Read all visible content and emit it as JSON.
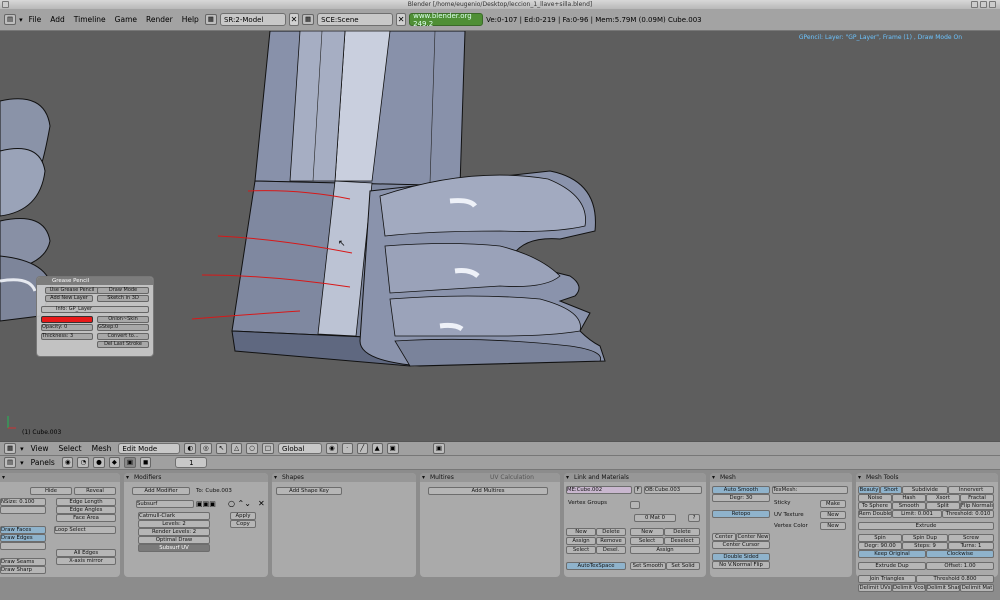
{
  "window_title": "Blender [/home/eugenio/Desktop/leccion_1_llave+silla.blend]",
  "menu": [
    "File",
    "Add",
    "Timeline",
    "Game",
    "Render",
    "Help"
  ],
  "screen_field": "SR:2-Model",
  "scene_field": "SCE:Scene",
  "website": "www.blender.org 249.2",
  "stats": "Ve:0-107 | Ed:0-219 | Fa:0-96 | Mem:5.79M (0.09M) Cube.003",
  "gp_info": "GPencil: Layer: \"GP_Layer\", Frame (1) , Draw Mode On",
  "object_info": "(1) Cube.003",
  "grease_pencil": {
    "title": "Grease Pencil",
    "use_btn": "Use Grease Pencil",
    "draw_mode": "Draw Mode",
    "add_layer": "Add New Layer",
    "sketch": "Sketch in 3D",
    "layer": "Info: GP_Layer",
    "onion": "Onion~Skin",
    "opacity": "Opacity: 0",
    "gstep": "GStep:0",
    "thickness": "Thickness: 3",
    "convert": "Convert to...",
    "del_stroke": "Del Last Stroke",
    "layer_color": "#e81818"
  },
  "view_header": {
    "view": "View",
    "select": "Select",
    "mesh": "Mesh",
    "mode": "Edit Mode",
    "orient": "Global"
  },
  "buttons_header": {
    "panels": "Panels",
    "frame": "1"
  },
  "panels": {
    "left": {
      "hide": "Hide",
      "reveal": "Reveal",
      "nsize": "NSize: 0.100",
      "edge_length": "Edge Length",
      "edge_angles": "Edge Angles",
      "face_area": "Face Area",
      "draw_faces": "Draw Faces",
      "draw_edges": "Draw Edges",
      "loop_select": "Loop Select",
      "all_edges": "All Edges",
      "xaxis_mirror": "X-axis mirror",
      "draw_seams": "Draw Seams",
      "draw_sharp": "Draw Sharp"
    },
    "modifiers": {
      "title": "Modifiers",
      "add": "Add Modifier",
      "to": "To: Cube.003",
      "subsurf": "Subsurf",
      "catmull": "Catmull-Clark",
      "levels": "Levels: 2",
      "render_levels": "Render Levels: 2",
      "optimal": "Optimal Draw",
      "subsurf_uv": "Subsurf UV",
      "apply": "Apply",
      "copy": "Copy"
    },
    "shapes": {
      "title": "Shapes",
      "add": "Add Shape Key"
    },
    "multires": {
      "title": "Multires",
      "tab2": "UV Calculation",
      "add": "Add Multires"
    },
    "link": {
      "title": "Link and Materials",
      "me": "ME:Cube.002",
      "f": "F",
      "ob": "OB:Cube.003",
      "vgroups": "Vertex Groups",
      "mat": "0 Mat 0",
      "q": "?",
      "new1": "New",
      "delete1": "Delete",
      "new2": "New",
      "delete2": "Delete",
      "assign1": "Assign",
      "remove": "Remove",
      "select1": "Select",
      "deselect1": "Deselect",
      "select2": "Select",
      "desel2": "Desel.",
      "assign2": "Assign",
      "autotex": "AutoTexSpace",
      "setsmooth": "Set Smooth",
      "setsolid": "Set Solid"
    },
    "mesh": {
      "title": "Mesh",
      "autosmooth": "Auto Smooth",
      "degr": "Degr: 30",
      "retopo": "Retopo",
      "texmesh": "TexMesh:",
      "sticky": "Sticky",
      "make": "Make",
      "uvtex": "UV Texture",
      "new1": "New",
      "vcolor": "Vertex Color",
      "new2": "New",
      "center": "Center",
      "centernew": "Center New",
      "centercursor": "Center Cursor",
      "doublesided": "Double Sided",
      "novnormal": "No V.Normal Flip"
    },
    "tools": {
      "title": "Mesh Tools",
      "beauty": "Beauty",
      "short": "Short",
      "subdivide": "Subdivide",
      "innervert": "Innervert",
      "noise": "Noise",
      "hash": "Hash",
      "xsort": "Xsort",
      "fractal": "Fractal",
      "tosphere": "To Sphere",
      "smooth": "Smooth",
      "split": "Split",
      "flipnormals": "Flip Normals",
      "remdoubles": "Rem Doubles",
      "limit": "Limit: 0.001",
      "threshold": "Threshold: 0.010",
      "extrude": "Extrude",
      "spin": "Spin",
      "spindup": "Spin Dup",
      "screw": "Screw",
      "degr": "Degr: 90.00",
      "steps": "Steps: 9",
      "turns": "Turns: 1",
      "keeporig": "Keep Original",
      "clockwise": "Clockwise",
      "extrudedup": "Extrude Dup",
      "offset": "Offset: 1.00",
      "jointri": "Join Triangles",
      "threshold2": "Threshold 0.800",
      "deluvs": "Delimit UVs",
      "delvcol": "Delimit Vcol",
      "delsharp": "Delimit Sharp",
      "delmat": "Delimit Mat"
    }
  }
}
